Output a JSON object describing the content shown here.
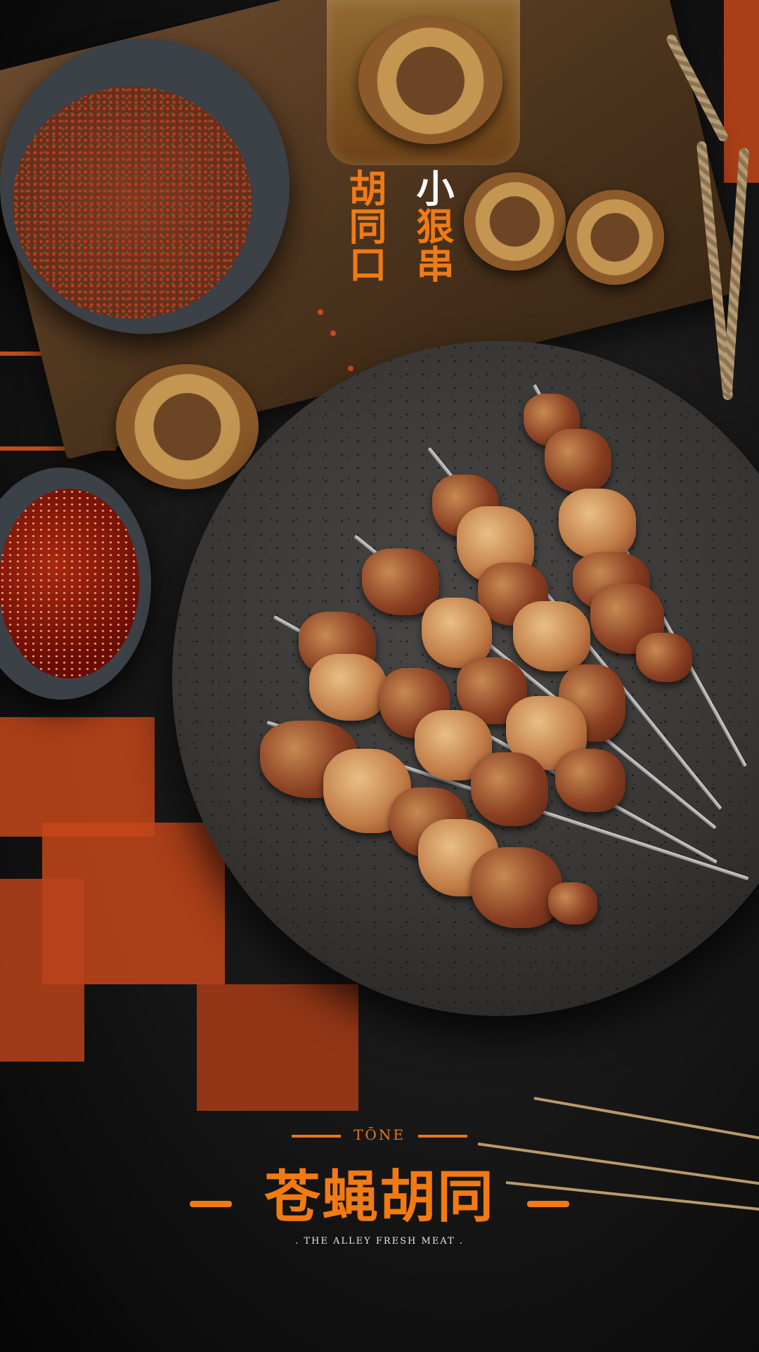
{
  "poster": {
    "vertical_title_left": "胡同口",
    "vertical_title_right_first": "小",
    "vertical_title_right_rest": "狠串",
    "brand_tag": "TŌNE",
    "brand_name": "苍蝇胡同",
    "brand_slogan": ". THE ALLEY   FRESH MEAT ."
  },
  "colors": {
    "accent_orange": "#f27a12",
    "background": "#111111"
  }
}
